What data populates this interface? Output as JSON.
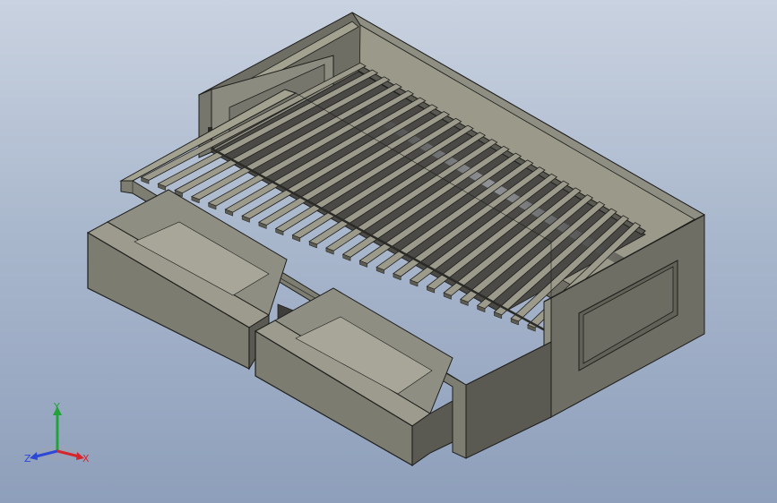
{
  "viewport": {
    "model": "day-bed-with-drawers",
    "background_top": "#c9d2e0",
    "background_bottom": "#8e9fbb"
  },
  "colors": {
    "frame_front": "#6f6e64",
    "frame_top": "#a3a291",
    "frame_side": "#85847a",
    "slat_top": "#9c9a8a",
    "slat_edge": "#5d5c53",
    "inner_dark": "#3a3a36",
    "drawer_front": "#7d7c71",
    "drawer_inner": "#8f8e83",
    "edge": "#1e1e1c"
  },
  "triad": {
    "x_label": "X",
    "y_label": "Y",
    "z_label": "Z",
    "x_color": "#d6262b",
    "y_color": "#22a33a",
    "z_color": "#2d47d6"
  }
}
